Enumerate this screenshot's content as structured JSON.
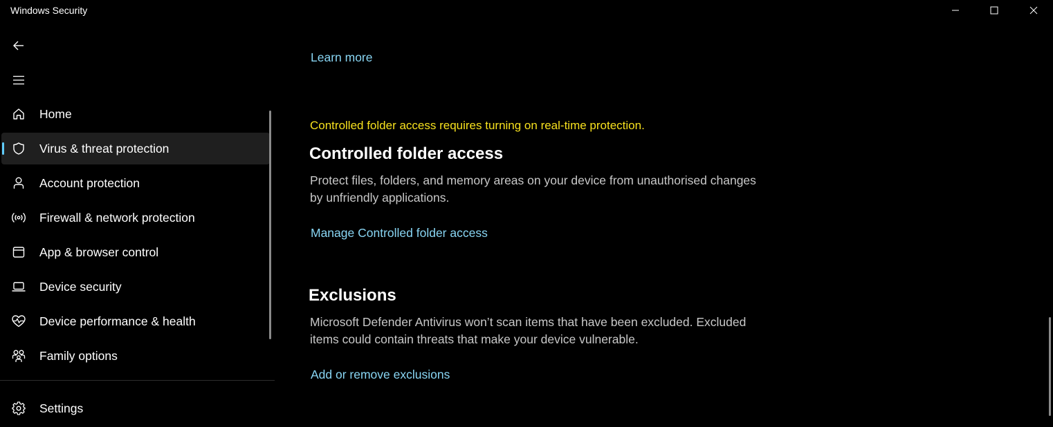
{
  "window": {
    "title": "Windows Security",
    "controls": [
      "minimize-icon",
      "maximize-icon",
      "close-icon"
    ]
  },
  "nav": {
    "back_icon": "back-arrow-icon",
    "menu_icon": "hamburger-menu-icon"
  },
  "sidebar": {
    "accent_color": "#60cdff",
    "items": [
      {
        "label": "Home",
        "icon": "home-icon",
        "selected": false
      },
      {
        "label": "Virus & threat protection",
        "icon": "shield-icon",
        "selected": true
      },
      {
        "label": "Account protection",
        "icon": "person-icon",
        "selected": false
      },
      {
        "label": "Firewall & network protection",
        "icon": "antenna-icon",
        "selected": false
      },
      {
        "label": "App & browser control",
        "icon": "app-window-icon",
        "selected": false
      },
      {
        "label": "Device security",
        "icon": "laptop-icon",
        "selected": false
      },
      {
        "label": "Device performance & health",
        "icon": "heart-pulse-icon",
        "selected": false
      },
      {
        "label": "Family options",
        "icon": "family-icon",
        "selected": false
      }
    ],
    "settings": {
      "label": "Settings",
      "icon": "gear-icon"
    }
  },
  "main": {
    "learn_more": "Learn more",
    "warning": "Controlled folder access requires turning on real-time protection.",
    "warning_color": "#f7e11e",
    "link_color": "#89d6f4",
    "cfa": {
      "title": "Controlled folder access",
      "description": "Protect files, folders, and memory areas on your device from unauthorised changes by unfriendly applications.",
      "link": "Manage Controlled folder access"
    },
    "exclusions": {
      "title": "Exclusions",
      "description": "Microsoft Defender Antivirus won’t scan items that have been excluded. Excluded items could contain threats that make your device vulnerable.",
      "link": "Add or remove exclusions"
    }
  }
}
